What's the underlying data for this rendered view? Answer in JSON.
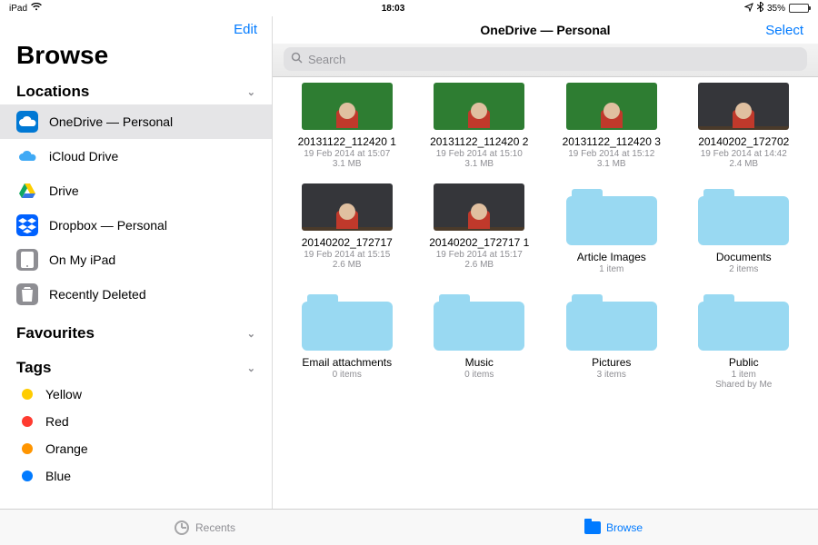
{
  "status": {
    "device": "iPad",
    "time": "18:03",
    "battery_pct": "35%"
  },
  "sidebar": {
    "edit": "Edit",
    "title": "Browse",
    "sections": {
      "locations_label": "Locations",
      "favourites_label": "Favourites",
      "tags_label": "Tags"
    },
    "locations": [
      {
        "label": "OneDrive — Personal",
        "icon": "onedrive",
        "selected": true
      },
      {
        "label": "iCloud Drive",
        "icon": "icloud"
      },
      {
        "label": "Drive",
        "icon": "gdrive"
      },
      {
        "label": "Dropbox — Personal",
        "icon": "dropbox"
      },
      {
        "label": "On My iPad",
        "icon": "ipad"
      },
      {
        "label": "Recently Deleted",
        "icon": "trash"
      }
    ],
    "tags": [
      {
        "label": "Yellow",
        "color": "#ffcc00"
      },
      {
        "label": "Red",
        "color": "#ff3b30"
      },
      {
        "label": "Orange",
        "color": "#ff9500"
      },
      {
        "label": "Blue",
        "color": "#007aff"
      }
    ]
  },
  "main": {
    "title": "OneDrive — Personal",
    "select": "Select",
    "search_placeholder": "Search",
    "items": [
      {
        "kind": "file",
        "name": "20131122_112420 1",
        "meta1": "19 Feb 2014 at 15:07",
        "meta2": "3.1 MB",
        "thumb": "green"
      },
      {
        "kind": "file",
        "name": "20131122_112420 2",
        "meta1": "19 Feb 2014 at 15:10",
        "meta2": "3.1 MB",
        "thumb": "green"
      },
      {
        "kind": "file",
        "name": "20131122_112420 3",
        "meta1": "19 Feb 2014 at 15:12",
        "meta2": "3.1 MB",
        "thumb": "green"
      },
      {
        "kind": "file",
        "name": "20140202_172702",
        "meta1": "19 Feb 2014 at 14:42",
        "meta2": "2.4 MB",
        "thumb": "shelf"
      },
      {
        "kind": "file",
        "name": "20140202_172717",
        "meta1": "19 Feb 2014 at 15:15",
        "meta2": "2.6 MB",
        "thumb": "shelf"
      },
      {
        "kind": "file",
        "name": "20140202_172717 1",
        "meta1": "19 Feb 2014 at 15:17",
        "meta2": "2.6 MB",
        "thumb": "shelf"
      },
      {
        "kind": "folder",
        "name": "Article Images",
        "meta1": "1 item",
        "meta2": ""
      },
      {
        "kind": "folder",
        "name": "Documents",
        "meta1": "2 items",
        "meta2": ""
      },
      {
        "kind": "folder",
        "name": "Email attachments",
        "meta1": "0 items",
        "meta2": ""
      },
      {
        "kind": "folder",
        "name": "Music",
        "meta1": "0 items",
        "meta2": ""
      },
      {
        "kind": "folder",
        "name": "Pictures",
        "meta1": "3 items",
        "meta2": ""
      },
      {
        "kind": "folder",
        "name": "Public",
        "meta1": "1 item",
        "meta2": "Shared by Me"
      }
    ]
  },
  "tabbar": {
    "recents": "Recents",
    "browse": "Browse"
  }
}
